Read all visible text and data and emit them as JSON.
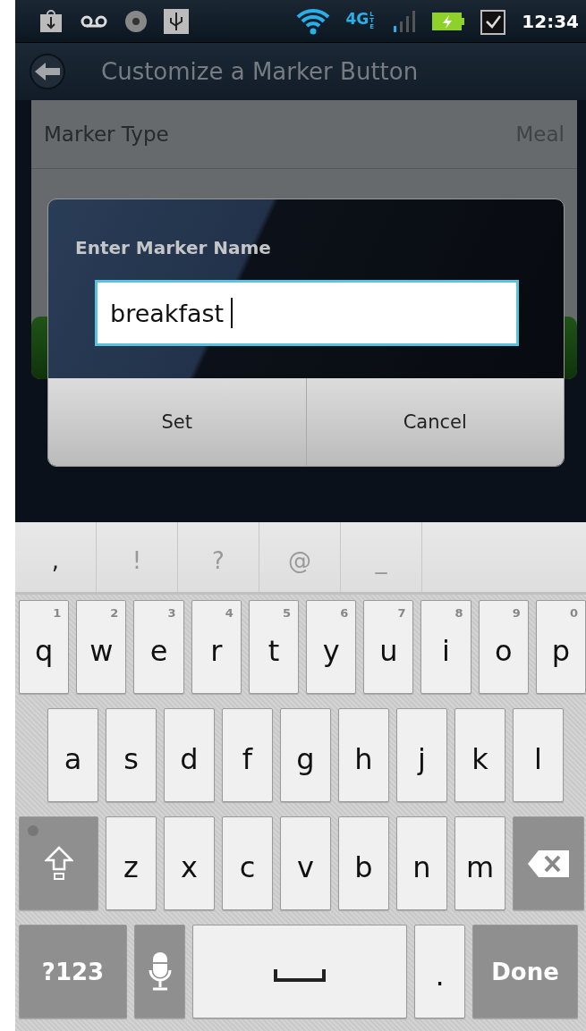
{
  "status_bar": {
    "network": "4G",
    "network_sub": "LTE",
    "time": "12:34"
  },
  "header": {
    "title": "Customize a Marker Button"
  },
  "settings": [
    {
      "label": "Marker Type",
      "value": "Meal"
    }
  ],
  "dialog": {
    "title": "Enter Marker Name",
    "input": {
      "value": "breakfast"
    },
    "buttons": [
      "Set",
      "Cancel"
    ]
  },
  "keyboard": {
    "suggestions": [
      ",",
      "!",
      "?",
      "@",
      "_"
    ],
    "rows": [
      [
        {
          "kind": "char",
          "label": "q",
          "hint": "1"
        },
        {
          "kind": "char",
          "label": "w",
          "hint": "2"
        },
        {
          "kind": "char",
          "label": "e",
          "hint": "3"
        },
        {
          "kind": "char",
          "label": "r",
          "hint": "4"
        },
        {
          "kind": "char",
          "label": "t",
          "hint": "5"
        },
        {
          "kind": "char",
          "label": "y",
          "hint": "6"
        },
        {
          "kind": "char",
          "label": "u",
          "hint": "7"
        },
        {
          "kind": "char",
          "label": "i",
          "hint": "8"
        },
        {
          "kind": "char",
          "label": "o",
          "hint": "9"
        },
        {
          "kind": "char",
          "label": "p",
          "hint": "0"
        }
      ],
      [
        {
          "kind": "char",
          "label": "a"
        },
        {
          "kind": "char",
          "label": "s"
        },
        {
          "kind": "char",
          "label": "d"
        },
        {
          "kind": "char",
          "label": "f"
        },
        {
          "kind": "char",
          "label": "g"
        },
        {
          "kind": "char",
          "label": "h"
        },
        {
          "kind": "char",
          "label": "j"
        },
        {
          "kind": "char",
          "label": "k"
        },
        {
          "kind": "char",
          "label": "l"
        }
      ],
      [
        {
          "kind": "shift"
        },
        {
          "kind": "char",
          "label": "z"
        },
        {
          "kind": "char",
          "label": "x"
        },
        {
          "kind": "char",
          "label": "c"
        },
        {
          "kind": "char",
          "label": "v"
        },
        {
          "kind": "char",
          "label": "b"
        },
        {
          "kind": "char",
          "label": "n"
        },
        {
          "kind": "char",
          "label": "m"
        },
        {
          "kind": "backspace"
        }
      ]
    ],
    "function_row": [
      {
        "kind": "symbols",
        "label": "?123"
      },
      {
        "kind": "mic"
      },
      {
        "kind": "space"
      },
      {
        "kind": "char",
        "label": "."
      },
      {
        "kind": "done",
        "label": "Done"
      }
    ]
  }
}
